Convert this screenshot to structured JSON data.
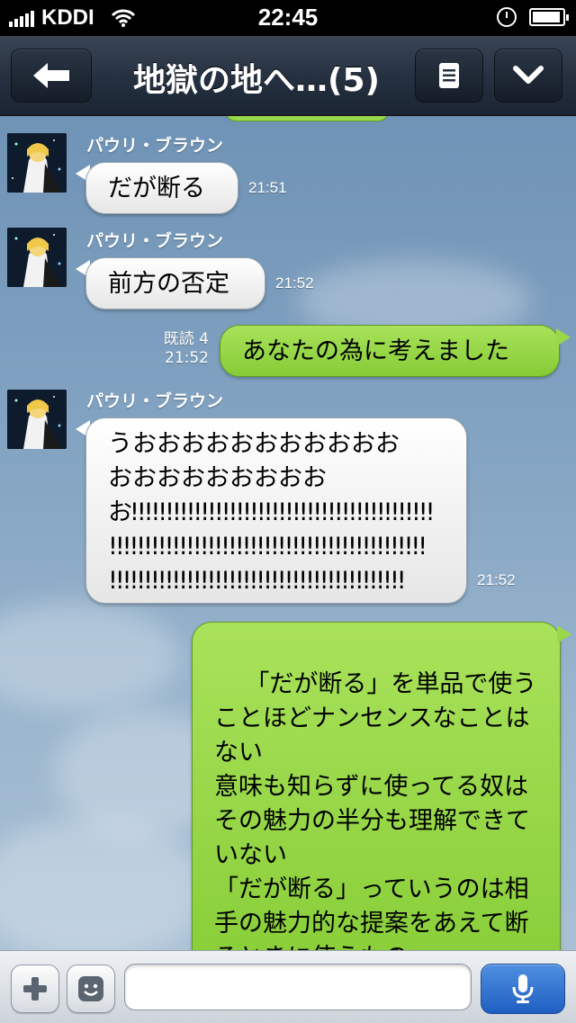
{
  "status_bar": {
    "carrier": "KDDI",
    "time": "22:45"
  },
  "nav": {
    "title": "地獄の地へ…(5)",
    "back_icon": "back-arrow-icon",
    "menu_icon": "menu-icon",
    "chevron_icon": "chevron-down-icon"
  },
  "messages": [
    {
      "sender": "パウリ・ブラウン",
      "text": "だが断る",
      "time": "21:51"
    },
    {
      "sender": "パウリ・ブラウン",
      "text": "前方の否定",
      "time": "21:52"
    },
    {
      "read": "既読 4",
      "text": "あなたの為に考えました",
      "time": "21:52"
    },
    {
      "sender": "パウリ・ブラウン",
      "line1": "うおおおおおおおおおおお",
      "line2": "おおおおおおおおお",
      "line3": "お!!!!!!!!!!!!!!!!!!!!!!!!!!!!!!!!!!!!!!!!!!!",
      "line4": "!!!!!!!!!!!!!!!!!!!!!!!!!!!!!!!!!!!!!!!!!!!!!",
      "line5": "!!!!!!!!!!!!!!!!!!!!!!!!!!!!!!!!!!!!!!!!!!",
      "time": "21:52"
    },
    {
      "text": "「だが断る」を単品で使うことほどナンセンスなことはない\n意味も知らずに使ってる奴はその魅力の半分も理解できていない\n「だが断る」っていうのは相手の魅力的な提案をあえて断るときに使うもの\n（これを知らずに使ってい"
    }
  ],
  "input_bar": {
    "value": "",
    "placeholder": ""
  },
  "colors": {
    "bubble_out": "#9ad84a",
    "bubble_in": "#ffffff",
    "navbar": "#243040",
    "mic": "#2f6fd0"
  }
}
